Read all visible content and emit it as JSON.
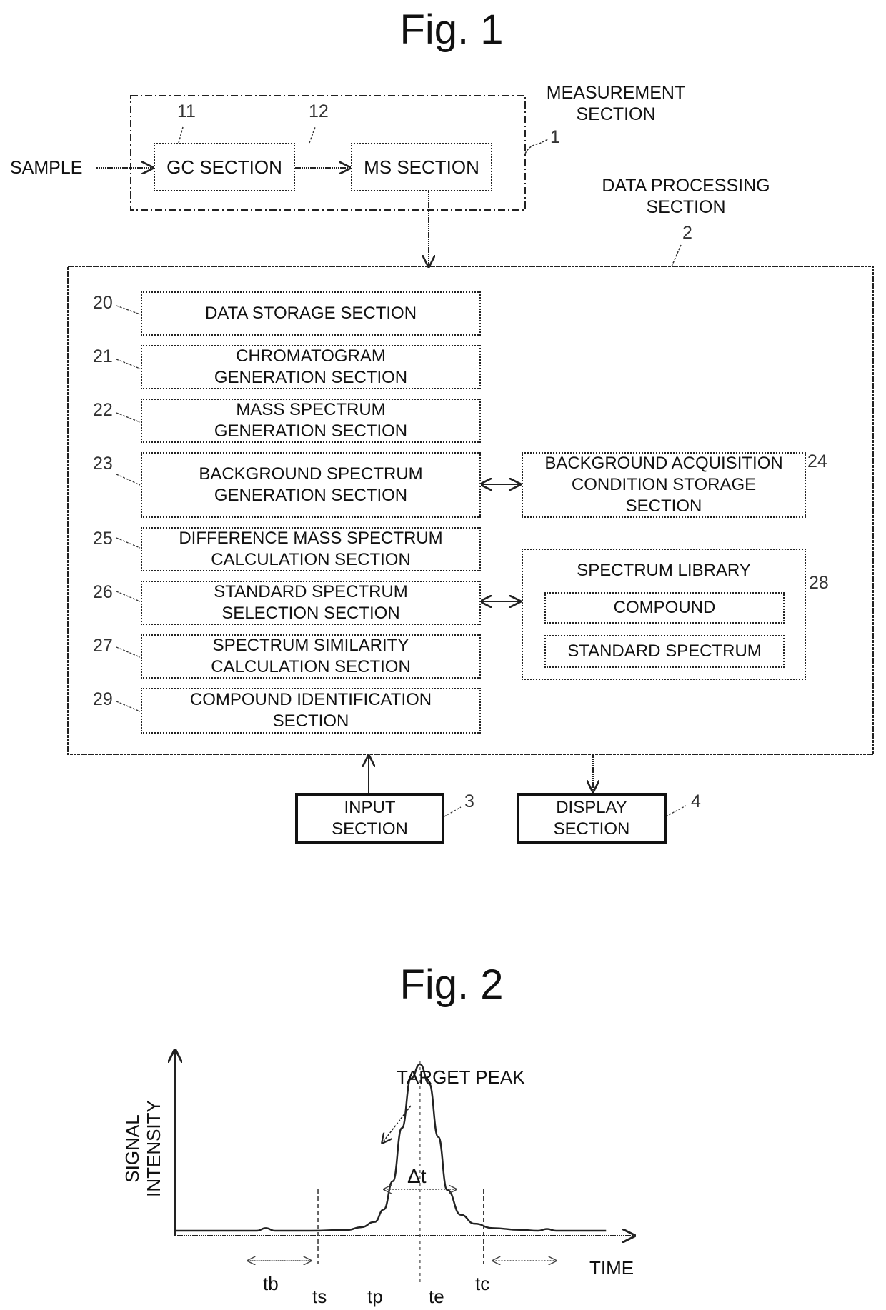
{
  "fig1": {
    "title": "Fig. 1",
    "sample_label": "SAMPLE",
    "measurement": {
      "label": "MEASUREMENT\nSECTION",
      "ref": "1",
      "gc": {
        "label": "GC SECTION",
        "ref": "11"
      },
      "ms": {
        "label": "MS SECTION",
        "ref": "12"
      }
    },
    "processing": {
      "label": "DATA PROCESSING\nSECTION",
      "ref": "2",
      "blocks": [
        {
          "ref": "20",
          "label": "DATA STORAGE SECTION"
        },
        {
          "ref": "21",
          "label": "CHROMATOGRAM\nGENERATION SECTION"
        },
        {
          "ref": "22",
          "label": "MASS SPECTRUM\nGENERATION SECTION"
        },
        {
          "ref": "23",
          "label": "BACKGROUND SPECTRUM\nGENERATION SECTION"
        },
        {
          "ref": "25",
          "label": "DIFFERENCE MASS SPECTRUM\nCALCULATION SECTION"
        },
        {
          "ref": "26",
          "label": "STANDARD SPECTRUM\nSELECTION SECTION"
        },
        {
          "ref": "27",
          "label": "SPECTRUM SIMILARITY\nCALCULATION SECTION"
        },
        {
          "ref": "29",
          "label": "COMPOUND IDENTIFICATION\nSECTION"
        }
      ],
      "bg_condition": {
        "ref": "24",
        "label": "BACKGROUND ACQUISITION\nCONDITION STORAGE\nSECTION"
      },
      "library": {
        "ref": "28",
        "label": "SPECTRUM LIBRARY",
        "compound": "COMPOUND",
        "standard": "STANDARD SPECTRUM"
      }
    },
    "input": {
      "label": "INPUT\nSECTION",
      "ref": "3"
    },
    "display": {
      "label": "DISPLAY\nSECTION",
      "ref": "4"
    }
  },
  "fig2": {
    "title": "Fig. 2",
    "chart_data": {
      "type": "line",
      "title": "",
      "xlabel": "TIME",
      "ylabel": "SIGNAL\nINTENSITY",
      "annotation": "TARGET PEAK",
      "delta_label": "Δt",
      "markers": {
        "tb": "tb",
        "ts": "ts",
        "tp": "tp",
        "te": "te",
        "tc": "tc"
      },
      "x_range": [
        0,
        100
      ],
      "y_range": [
        0,
        100
      ],
      "x": [
        0,
        10,
        18,
        20,
        22,
        30,
        38,
        41,
        44,
        46,
        48,
        50,
        52,
        54,
        56,
        58,
        60,
        63,
        66,
        70,
        76,
        80,
        82,
        84,
        90,
        95
      ],
      "y": [
        2,
        2,
        2,
        3.5,
        2,
        2,
        2.5,
        4,
        7,
        14,
        30,
        60,
        88,
        96,
        85,
        55,
        25,
        11,
        6,
        3.5,
        2.5,
        2,
        3,
        2,
        2,
        2
      ],
      "tb_range": [
        16,
        30
      ],
      "ts": 31.5,
      "tp": 54,
      "te": 68,
      "tc_range": [
        70,
        84
      ],
      "delta_t_range": [
        46,
        62
      ],
      "grid": false
    }
  }
}
